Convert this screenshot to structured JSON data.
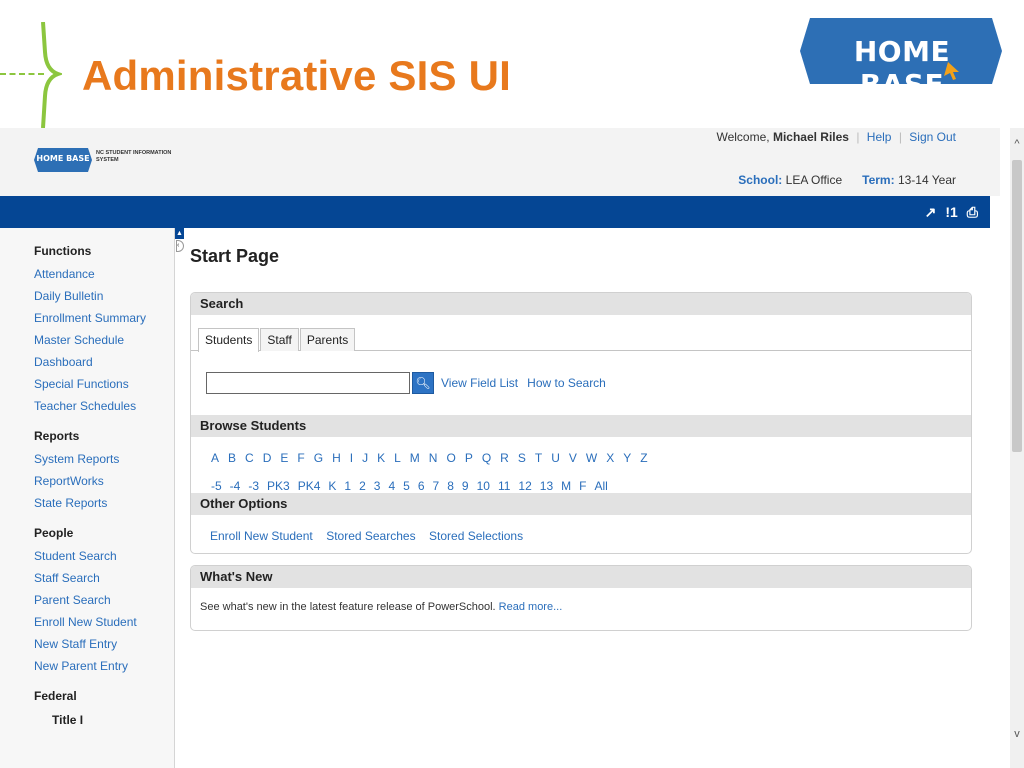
{
  "slide": {
    "title": "Administrative SIS UI",
    "logo_text": "HOME BASE"
  },
  "colors": {
    "title_orange": "#e8791d",
    "accent_green": "#8cc63f",
    "logo_blue": "#2d6fb5",
    "navbar_blue": "#054694",
    "link_blue": "#2a6ebb"
  },
  "app": {
    "logo_small_text": "HOME BASE",
    "logo_sub_text": "NC STUDENT INFORMATION SYSTEM",
    "welcome_prefix": "Welcome,",
    "user_name": "Michael Riles",
    "help_label": "Help",
    "signout_label": "Sign Out",
    "school_label": "School:",
    "school_value": "LEA Office",
    "term_label": "Term:",
    "term_value": "13-14 Year",
    "nav_icons": [
      "link-arrow-icon",
      "alert-icon",
      "print-icon"
    ]
  },
  "sidebar": {
    "functions_heading": "Functions",
    "functions": [
      "Attendance",
      "Daily Bulletin",
      "Enrollment Summary",
      "Master Schedule",
      "Dashboard",
      "Special Functions",
      "Teacher Schedules"
    ],
    "reports_heading": "Reports",
    "reports": [
      "System Reports",
      "ReportWorks",
      "State Reports"
    ],
    "people_heading": "People",
    "people": [
      "Student Search",
      "Staff Search",
      "Parent Search",
      "Enroll New Student",
      "New Staff Entry",
      "New Parent Entry"
    ],
    "federal_heading": "Federal",
    "federal_sub": "Title I"
  },
  "main": {
    "page_title": "Start Page",
    "search_heading": "Search",
    "tabs": [
      "Students",
      "Staff",
      "Parents"
    ],
    "search_value": "",
    "view_field_list": "View Field List",
    "how_to_search": "How to Search",
    "browse_heading": "Browse Students",
    "letters": [
      "A",
      "B",
      "C",
      "D",
      "E",
      "F",
      "G",
      "H",
      "I",
      "J",
      "K",
      "L",
      "M",
      "N",
      "O",
      "P",
      "Q",
      "R",
      "S",
      "T",
      "U",
      "V",
      "W",
      "X",
      "Y",
      "Z"
    ],
    "grades": [
      "-5",
      "-4",
      "-3",
      "PK3",
      "PK4",
      "K",
      "1",
      "2",
      "3",
      "4",
      "5",
      "6",
      "7",
      "8",
      "9",
      "10",
      "11",
      "12",
      "13",
      "M",
      "F",
      "All"
    ],
    "other_heading": "Other Options",
    "other_links": [
      "Enroll New Student",
      "Stored Searches",
      "Stored Selections"
    ],
    "whats_new_heading": "What's New",
    "whats_new_text": "See what's new in the latest feature release of PowerSchool.",
    "read_more": "Read more..."
  }
}
